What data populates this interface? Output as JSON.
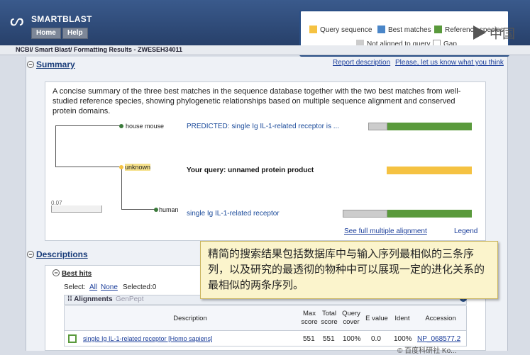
{
  "app": {
    "brand": "SMARTBLAST",
    "nav": [
      "Home",
      "Help"
    ]
  },
  "breadcrumb": "NCBI/ Smart Blast/ Formatting Results - ZWESEH34011",
  "legend": {
    "items": [
      {
        "label": "Query sequence",
        "color": "#f5c242"
      },
      {
        "label": "Best matches",
        "color": "#4a86c8"
      },
      {
        "label": "Reference species",
        "color": "#5a9a3c"
      },
      {
        "label": "Not aligned to query",
        "color": "#cccccc"
      },
      {
        "label": "Gap",
        "color": "#ffffff"
      }
    ]
  },
  "watermark_top": "中国",
  "summary": {
    "heading": "Summary",
    "links": [
      "Report description",
      "Please, let us know what you think"
    ],
    "text": "A concise summary of the three best matches in the sequence database together with the two best matches from well-studied reference species, showing phylogenetic relationships based on multiple sequence alignment and conserved protein domains.",
    "tree_leaves": [
      "house mouse",
      "unknown",
      "human"
    ],
    "scale": "0.07",
    "rows": [
      {
        "label": "PREDICTED: single Ig IL-1-related receptor is ..."
      },
      {
        "label": "Your query: unnamed protein product"
      },
      {
        "label": "single Ig IL-1-related receptor"
      }
    ],
    "see_full": "See full multiple alignment",
    "legend_link": "Legend"
  },
  "descriptions": {
    "heading": "Descriptions",
    "best_hits": "Best hits",
    "select_label": "Select:",
    "select_all": "All",
    "select_none": "None",
    "selected": "Selected:0",
    "alignments": "Alignments",
    "genpept": "GenPept",
    "columns": [
      "Description",
      "Max score",
      "Total score",
      "Query cover",
      "E value",
      "Ident",
      "Accession"
    ],
    "rows": [
      {
        "description": "single Ig IL-1-related receptor [Homo sapiens]",
        "max_score": "551",
        "total_score": "551",
        "query_cover": "100%",
        "e_value": "0.0",
        "ident": "100%",
        "accession": "NP_068577.2"
      }
    ]
  },
  "callout": "精简的搜索结果包括数据库中与输入序列最相似的三条序列，以及研究的最透彻的物种中可以展现一定的进化关系的最相似的两条序列。",
  "watermark_bottom": "© 百度科研社 Ko..."
}
